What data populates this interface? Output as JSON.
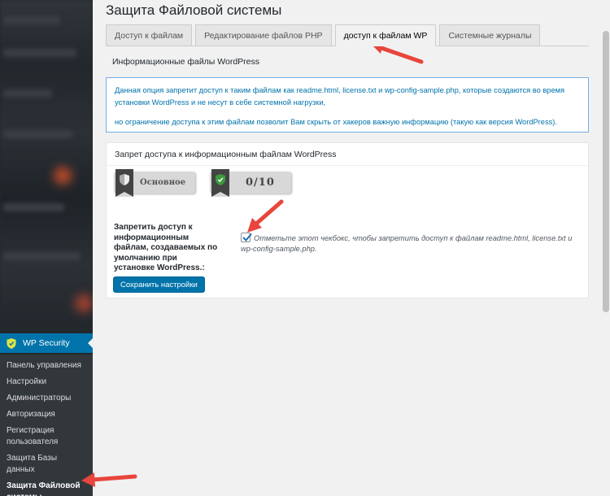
{
  "page": {
    "title": "Защита Файловой системы"
  },
  "tabs": [
    {
      "label": "Доступ к файлам",
      "active": false
    },
    {
      "label": "Редактирование файлов PHP",
      "active": false
    },
    {
      "label": "доступ к файлам WP",
      "active": true
    },
    {
      "label": "Системные журналы",
      "active": false
    }
  ],
  "section": {
    "title": "Информационные файлы WordPress"
  },
  "info": {
    "line1": "Данная опция запретит доступ к таким файлам как readme.html, license.txt и wp-config-sample.php, которые создаются во время установки WordPress и не несут в себе системной нагрузки,",
    "line2": "но ограничение доступа к этим файлам позволит Вам скрыть от хакеров важную информацию (такую как версия WordPress)."
  },
  "panel": {
    "title": "Запрет доступа к информационным файлам WordPress",
    "badge_basic": "Основное",
    "badge_score": "0/10",
    "field_label": "Запретить доступ к информационным файлам, создаваемых по умолчанию при установке WordPress.:",
    "checkbox_checked": true,
    "field_desc": "Отметьте этот чекбокс, чтобы запретить доступ к файлам readme.html, license.txt и wp-config-sample.php.",
    "save_label": "Сохранить настройки"
  },
  "sidebar": {
    "plugin_label": "WP Security",
    "items": [
      {
        "label": "Панель управления",
        "active": false
      },
      {
        "label": "Настройки",
        "active": false
      },
      {
        "label": "Администраторы",
        "active": false
      },
      {
        "label": "Авторизация",
        "active": false
      },
      {
        "label": "Регистрация пользователя",
        "active": false
      },
      {
        "label": "Защита Базы данных",
        "active": false
      },
      {
        "label": "Защита Файловой системы",
        "active": true
      }
    ]
  },
  "colors": {
    "accent": "#0073aa",
    "arrow": "#e8453c",
    "sidebar": "#23282d"
  }
}
